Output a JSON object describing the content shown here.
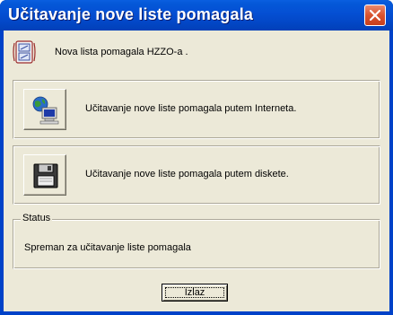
{
  "window": {
    "title": "Učitavanje nove liste pomagala",
    "close_icon": "close-icon",
    "accent": "#0458d8"
  },
  "info": {
    "icon": "list-document-icon",
    "text": "Nova lista pomagala HZZO-a ."
  },
  "options": {
    "internet": {
      "icon": "globe-computer-icon",
      "label": "Učitavanje nove liste pomagala putem Interneta."
    },
    "diskette": {
      "icon": "floppy-disk-icon",
      "label": "Učitavanje nove liste pomagala putem diskete."
    }
  },
  "status": {
    "legend": "Status",
    "text": "Spreman za učitavanje liste pomagala"
  },
  "exit_button": {
    "label": "Izlaz"
  }
}
